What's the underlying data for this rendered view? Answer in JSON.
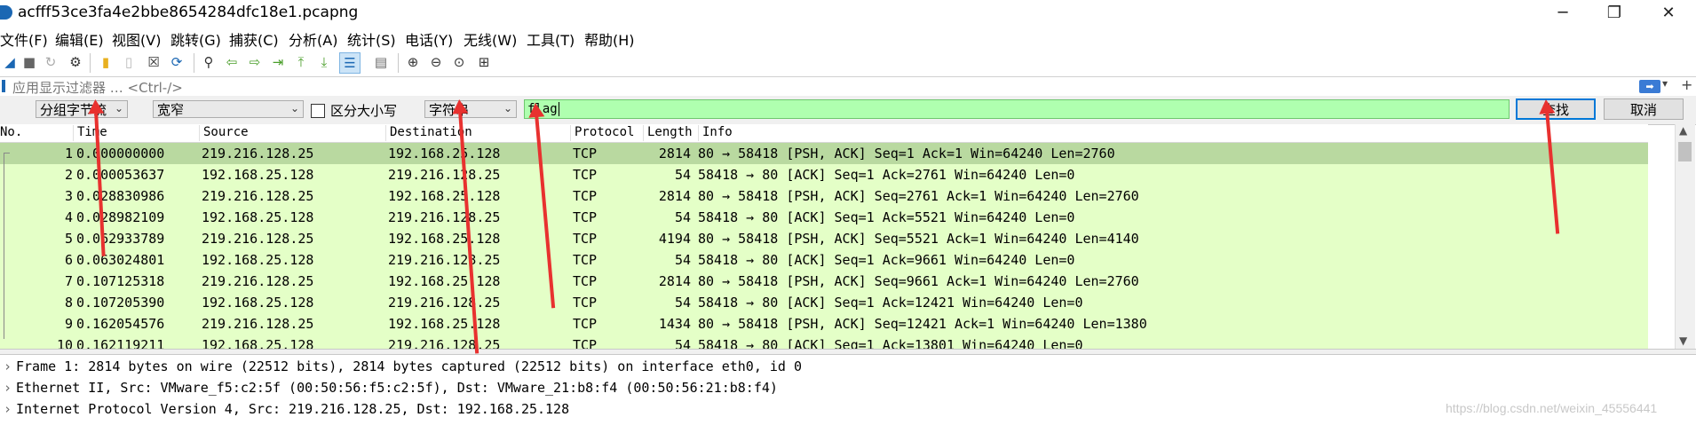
{
  "window": {
    "title": "acfff53ce3fa4e2bbe8654284dfc18e1.pcapng",
    "minimize": "─",
    "maximize": "❐",
    "close": "✕"
  },
  "menu": [
    "文件(F)",
    "编辑(E)",
    "视图(V)",
    "跳转(G)",
    "捕获(C)",
    "分析(A)",
    "统计(S)",
    "电话(Y)",
    "无线(W)",
    "工具(T)",
    "帮助(H)"
  ],
  "toolbar": {
    "icons": [
      "shark-fin-icon",
      "stop-icon",
      "restart-icon",
      "options-gear-icon",
      "open-folder-icon",
      "save-file-icon",
      "close-file-icon",
      "reload-icon",
      "find-icon",
      "back-arrow-icon",
      "forward-arrow-icon",
      "goto-packet-icon",
      "first-packet-icon",
      "last-packet-icon",
      "autoscroll-icon",
      "colorize-icon",
      "zoom-in-icon",
      "zoom-out-icon",
      "zoom-reset-icon",
      "resize-columns-icon"
    ]
  },
  "display_filter": {
    "placeholder": "应用显示过滤器 … <Ctrl-/>"
  },
  "find_bar": {
    "search_in": "分组字节流",
    "char_width": "宽窄",
    "case_sensitive_label": "区分大小写",
    "search_type": "字符串",
    "search_value": "flag",
    "find_button": "查找",
    "cancel_button": "取消"
  },
  "packet_list": {
    "columns": [
      "No.",
      "Time",
      "Source",
      "Destination",
      "Protocol",
      "Length",
      "Info"
    ],
    "rows": [
      {
        "no": "1",
        "time": "0.000000000",
        "src": "219.216.128.25",
        "dst": "192.168.25.128",
        "proto": "TCP",
        "len": "2814",
        "info": "80 → 58418 [PSH, ACK] Seq=1 Ack=1 Win=64240 Len=2760"
      },
      {
        "no": "2",
        "time": "0.000053637",
        "src": "192.168.25.128",
        "dst": "219.216.128.25",
        "proto": "TCP",
        "len": "54",
        "info": "58418 → 80 [ACK] Seq=1 Ack=2761 Win=64240 Len=0"
      },
      {
        "no": "3",
        "time": "0.028830986",
        "src": "219.216.128.25",
        "dst": "192.168.25.128",
        "proto": "TCP",
        "len": "2814",
        "info": "80 → 58418 [PSH, ACK] Seq=2761 Ack=1 Win=64240 Len=2760"
      },
      {
        "no": "4",
        "time": "0.028982109",
        "src": "192.168.25.128",
        "dst": "219.216.128.25",
        "proto": "TCP",
        "len": "54",
        "info": "58418 → 80 [ACK] Seq=1 Ack=5521 Win=64240 Len=0"
      },
      {
        "no": "5",
        "time": "0.062933789",
        "src": "219.216.128.25",
        "dst": "192.168.25.128",
        "proto": "TCP",
        "len": "4194",
        "info": "80 → 58418 [PSH, ACK] Seq=5521 Ack=1 Win=64240 Len=4140"
      },
      {
        "no": "6",
        "time": "0.063024801",
        "src": "192.168.25.128",
        "dst": "219.216.128.25",
        "proto": "TCP",
        "len": "54",
        "info": "58418 → 80 [ACK] Seq=1 Ack=9661 Win=64240 Len=0"
      },
      {
        "no": "7",
        "time": "0.107125318",
        "src": "219.216.128.25",
        "dst": "192.168.25.128",
        "proto": "TCP",
        "len": "2814",
        "info": "80 → 58418 [PSH, ACK] Seq=9661 Ack=1 Win=64240 Len=2760"
      },
      {
        "no": "8",
        "time": "0.107205390",
        "src": "192.168.25.128",
        "dst": "219.216.128.25",
        "proto": "TCP",
        "len": "54",
        "info": "58418 → 80 [ACK] Seq=1 Ack=12421 Win=64240 Len=0"
      },
      {
        "no": "9",
        "time": "0.162054576",
        "src": "219.216.128.25",
        "dst": "192.168.25.128",
        "proto": "TCP",
        "len": "1434",
        "info": "80 → 58418 [PSH, ACK] Seq=12421 Ack=1 Win=64240 Len=1380"
      },
      {
        "no": "10",
        "time": "0.162119211",
        "src": "192.168.25.128",
        "dst": "219.216.128.25",
        "proto": "TCP",
        "len": "54",
        "info": "58418 → 80 [ACK] Seq=1 Ack=13801 Win=64240 Len=0"
      }
    ]
  },
  "packet_details": [
    "Frame 1: 2814 bytes on wire (22512 bits), 2814 bytes captured (22512 bits) on interface eth0, id 0",
    "Ethernet II, Src: VMware_f5:c2:5f (00:50:56:f5:c2:5f), Dst: VMware_21:b8:f4 (00:50:56:21:b8:f4)",
    "Internet Protocol Version 4, Src: 219.216.128.25, Dst: 192.168.25.128"
  ],
  "watermark": "https://blog.csdn.net/weixin_45556441",
  "colors": {
    "row_bg": "#e4ffc7",
    "row_selected": "#b9d9a0",
    "search_field_bg": "#afffaf",
    "annotation_arrow": "#e8312f"
  }
}
